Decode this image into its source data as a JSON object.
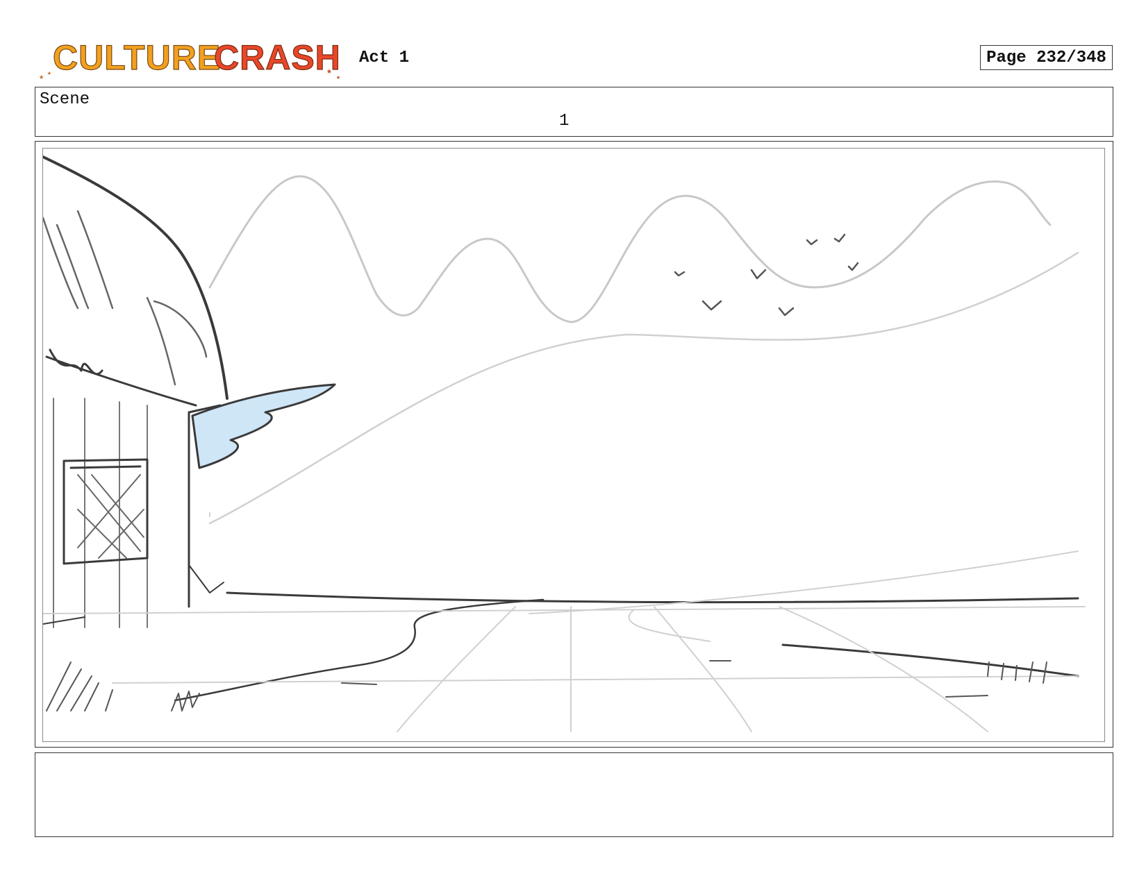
{
  "header": {
    "logo_text": "CULTURE CRASH",
    "act_label": "Act 1",
    "page_label": "Page 232/348"
  },
  "scene": {
    "label": "Scene",
    "number": "1"
  },
  "panel": {
    "notes": ""
  },
  "colors": {
    "logo_orange": "#f2a020",
    "logo_red": "#e8472a",
    "sketch_dark": "#3a3a3a",
    "sketch_light": "#c8c8c8",
    "awning_blue": "#cfe6f7"
  }
}
